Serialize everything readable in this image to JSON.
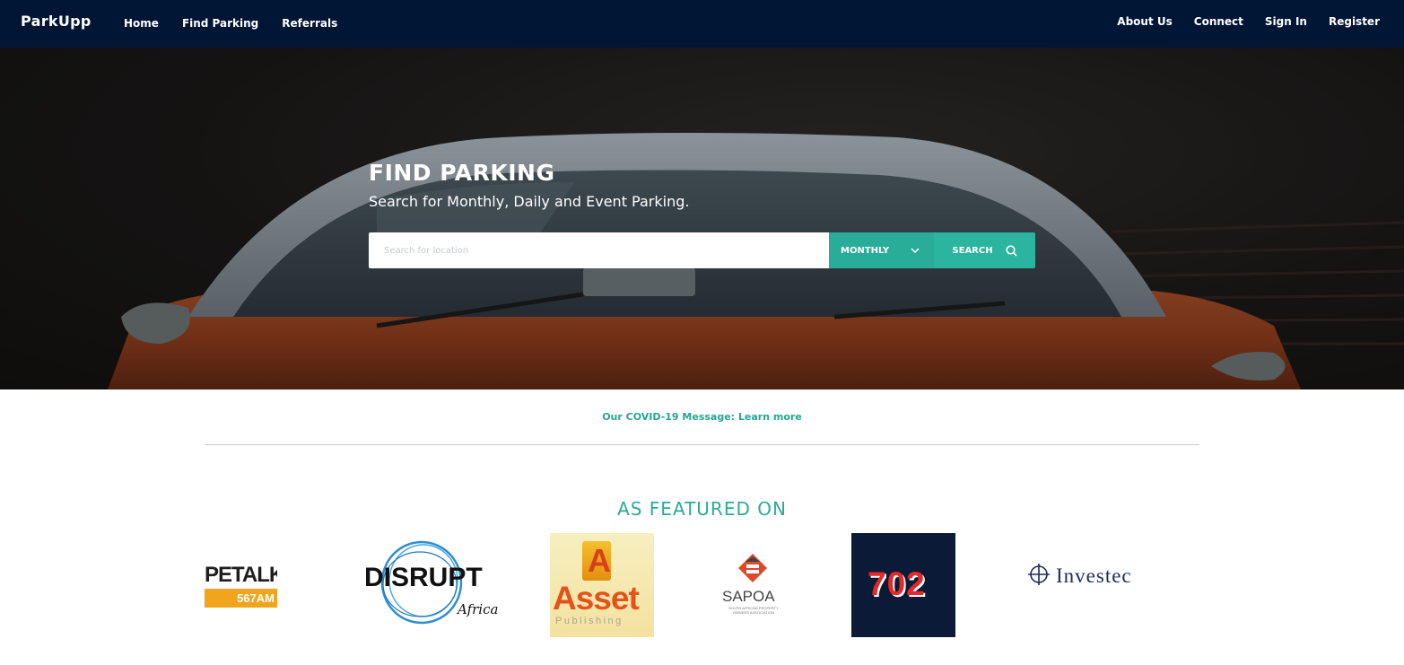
{
  "navbar": {
    "brand": "ParkUpp",
    "left_links": [
      "Home",
      "Find Parking",
      "Referrals"
    ],
    "right_links": [
      "About Us",
      "Connect",
      "Sign In",
      "Register"
    ]
  },
  "hero": {
    "title": "FIND PARKING",
    "subtitle": "Search for Monthly, Daily and Event Parking.",
    "search": {
      "placeholder": "Search for location",
      "value": "",
      "period_selected": "MONTHLY",
      "button_label": "SEARCH"
    }
  },
  "covid": {
    "text": "Our COVID-19 Message: ",
    "link_label": "Learn more"
  },
  "featured": {
    "title": "AS FEATURED ON",
    "logos": {
      "capetalk": {
        "main": "PETALK",
        "sub": "567AM"
      },
      "disrupt": {
        "main": "DISRUPT",
        "sub": "Africa"
      },
      "asset": {
        "letter": "A",
        "main": "Asset",
        "sub": "Publishing"
      },
      "sapoa": {
        "main": "SAPOA",
        "sub": "SOUTH AFRICAN PROPERTY OWNERS ASSOCIATION"
      },
      "radio702": {
        "main": "702"
      },
      "investec": {
        "main": "Investec"
      }
    }
  },
  "colors": {
    "navbar": "#011535",
    "accent": "#2bb59e",
    "accent_dark": "#29ad98"
  },
  "icons": [
    "chevron-down-icon",
    "search-icon",
    "investec-zebra-icon",
    "sapoa-emblem-icon"
  ]
}
